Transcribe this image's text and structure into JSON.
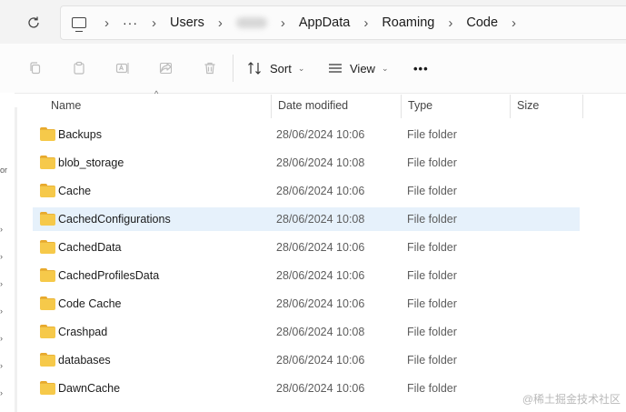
{
  "breadcrumb": {
    "items": [
      "Users",
      "AppData",
      "Roaming",
      "Code"
    ]
  },
  "toolbar": {
    "sort_label": "Sort",
    "view_label": "View",
    "more_label": "•••"
  },
  "columns": {
    "name": "Name",
    "date": "Date modified",
    "type": "Type",
    "size": "Size"
  },
  "files": [
    {
      "name": "Backups",
      "date": "28/06/2024 10:06",
      "type": "File folder"
    },
    {
      "name": "blob_storage",
      "date": "28/06/2024 10:08",
      "type": "File folder"
    },
    {
      "name": "Cache",
      "date": "28/06/2024 10:06",
      "type": "File folder"
    },
    {
      "name": "CachedConfigurations",
      "date": "28/06/2024 10:08",
      "type": "File folder",
      "selected": true
    },
    {
      "name": "CachedData",
      "date": "28/06/2024 10:06",
      "type": "File folder"
    },
    {
      "name": "CachedProfilesData",
      "date": "28/06/2024 10:06",
      "type": "File folder"
    },
    {
      "name": "Code Cache",
      "date": "28/06/2024 10:06",
      "type": "File folder"
    },
    {
      "name": "Crashpad",
      "date": "28/06/2024 10:08",
      "type": "File folder"
    },
    {
      "name": "databases",
      "date": "28/06/2024 10:06",
      "type": "File folder"
    },
    {
      "name": "DawnCache",
      "date": "28/06/2024 10:06",
      "type": "File folder"
    }
  ],
  "watermark": "@稀土掘金技术社区",
  "leftpane_mark": "or"
}
